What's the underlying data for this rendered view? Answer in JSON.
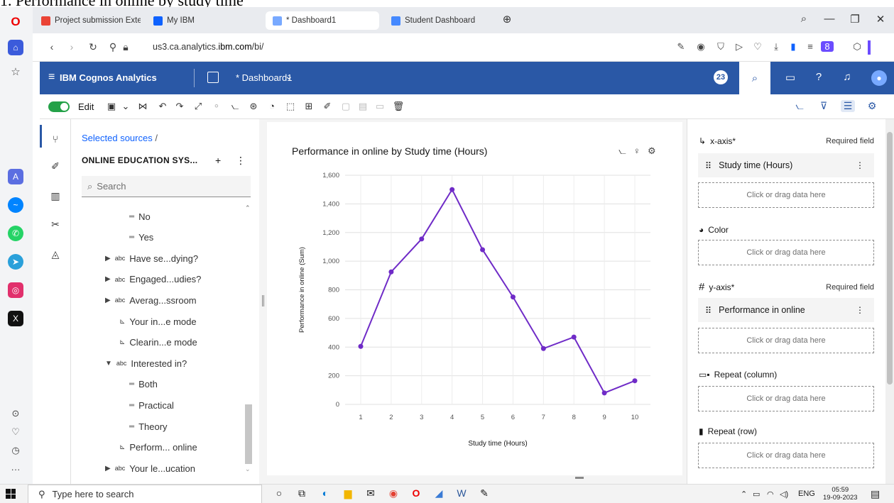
{
  "doc_heading": "1. Performance in online by study time",
  "tabs": [
    {
      "label": "Project submission Extend",
      "active": false
    },
    {
      "label": "My IBM",
      "active": false
    },
    {
      "label": "* Dashboard1",
      "active": true
    },
    {
      "label": "Student Dashboard",
      "active": false
    }
  ],
  "address": {
    "domain": "us3.ca.analytics.",
    "host": "ibm.com",
    "path": "/bi/"
  },
  "header": {
    "brand": "IBM Cognos Analytics",
    "dashboard_name": "* Dashboard1",
    "notification_count": "23"
  },
  "toolbar": {
    "edit_label": "Edit"
  },
  "source_panel": {
    "breadcrumb": "Selected sources",
    "breadcrumb_sep": "/",
    "source_name": "ONLINE EDUCATION SYS...",
    "search_placeholder": "Search",
    "tree": [
      {
        "label": "No",
        "kind": "member",
        "indent": 2
      },
      {
        "label": "Yes",
        "kind": "member",
        "indent": 2
      },
      {
        "label": "Have se...dying?",
        "kind": "abc",
        "indent": 1
      },
      {
        "label": "Engaged...udies?",
        "kind": "abc",
        "indent": 1
      },
      {
        "label": "Averag...ssroom",
        "kind": "abc",
        "indent": 1
      },
      {
        "label": "Your in...e mode",
        "kind": "measure",
        "indent": 1
      },
      {
        "label": "Clearin...e mode",
        "kind": "measure",
        "indent": 1
      },
      {
        "label": "Interested in?",
        "kind": "abc-open",
        "indent": 1
      },
      {
        "label": "Both",
        "kind": "member",
        "indent": 2
      },
      {
        "label": "Practical",
        "kind": "member",
        "indent": 2
      },
      {
        "label": "Theory",
        "kind": "member",
        "indent": 2
      },
      {
        "label": "Perform... online",
        "kind": "measure",
        "indent": 1
      },
      {
        "label": "Your le...ucation",
        "kind": "abc",
        "indent": 1
      }
    ]
  },
  "widget": {
    "title": "Performance in online by Study time (Hours)"
  },
  "chart_data": {
    "type": "line",
    "x": [
      1,
      2,
      3,
      4,
      5,
      6,
      7,
      8,
      9,
      10
    ],
    "values": [
      405,
      925,
      1155,
      1500,
      1080,
      750,
      390,
      470,
      80,
      165
    ],
    "xlabel": "Study time (Hours)",
    "ylabel": "Performance in online (Sum)",
    "ylim": [
      0,
      1600
    ],
    "yticks": [
      0,
      200,
      400,
      600,
      800,
      1000,
      1200,
      1400,
      1600
    ],
    "ytick_labels": [
      "0",
      "200",
      "400",
      "600",
      "800",
      "1,000",
      "1,200",
      "1,400",
      "1,600"
    ],
    "line_color": "#6f2bc7",
    "grid": true
  },
  "right_panel": {
    "xaxis": {
      "label": "x-axis*",
      "required": "Required field",
      "item": "Study time (Hours)",
      "drop": "Click or drag data here"
    },
    "color": {
      "label": "Color",
      "drop": "Click or drag data here"
    },
    "yaxis": {
      "label": "y-axis*",
      "required": "Required field",
      "item": "Performance in online",
      "drop": "Click or drag data here"
    },
    "repeat_col": {
      "label": "Repeat (column)",
      "drop": "Click or drag data here"
    },
    "repeat_row": {
      "label": "Repeat (row)",
      "drop": "Click or drag data here"
    }
  },
  "taskbar": {
    "search_placeholder": "Type here to search",
    "lang": "ENG",
    "time": "05:59",
    "date": "19-09-2023"
  },
  "colors": {
    "cognos_blue": "#2a58a6",
    "toggle_green": "#24a148",
    "series_purple": "#6f2bc7"
  }
}
